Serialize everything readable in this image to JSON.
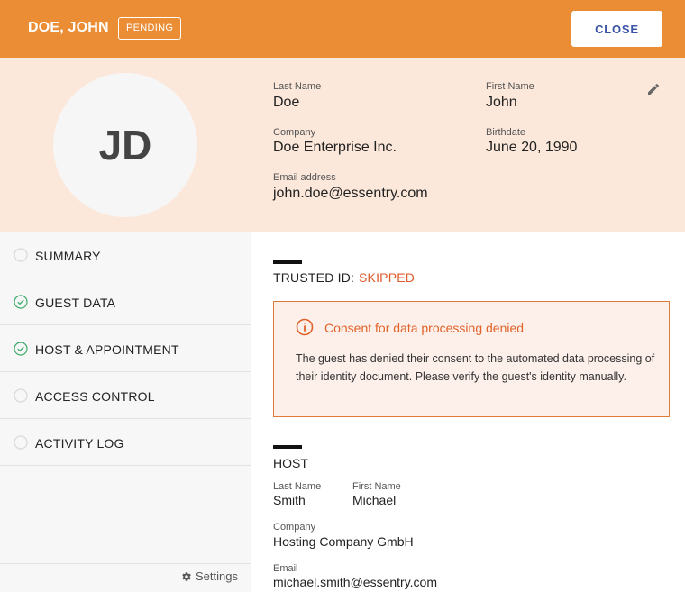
{
  "header": {
    "name": "DOE, JOHN",
    "status_badge": "PENDING",
    "close_label": "CLOSE"
  },
  "profile": {
    "initials": "JD",
    "last_name_label": "Last Name",
    "last_name": "Doe",
    "first_name_label": "First Name",
    "first_name": "John",
    "company_label": "Company",
    "company": "Doe Enterprise Inc.",
    "birthdate_label": "Birthdate",
    "birthdate": "June 20, 1990",
    "email_label": "Email address",
    "email": "john.doe@essentry.com"
  },
  "sidebar": {
    "items": [
      {
        "label": "SUMMARY",
        "completed": false
      },
      {
        "label": "GUEST DATA",
        "completed": true
      },
      {
        "label": "HOST & APPOINTMENT",
        "completed": true
      },
      {
        "label": "ACCESS CONTROL",
        "completed": false
      },
      {
        "label": "ACTIVITY LOG",
        "completed": false
      }
    ],
    "settings_label": "Settings"
  },
  "trusted_id": {
    "label": "TRUSTED ID:",
    "value": "SKIPPED"
  },
  "alert": {
    "title": "Consent for data processing denied",
    "body": "The guest has denied their consent to the automated data processing of their identity document. Please verify the guest's identity manually."
  },
  "host": {
    "title": "HOST",
    "last_name_label": "Last Name",
    "last_name": "Smith",
    "first_name_label": "First Name",
    "first_name": "Michael",
    "company_label": "Company",
    "company": "Hosting Company GmbH",
    "email_label": "Email",
    "email": "michael.smith@essentry.com"
  },
  "colors": {
    "accent": "#ea8d35",
    "profile_background": "#fce8da",
    "warning": "#e0622a",
    "check": "#3daa6a",
    "close_text": "#3b54a6"
  },
  "icons": {
    "edit": "pencil-icon",
    "alert": "info-circle-icon",
    "settings": "gear-icon",
    "completed": "check-circle-icon",
    "pending": "empty-circle-icon"
  }
}
